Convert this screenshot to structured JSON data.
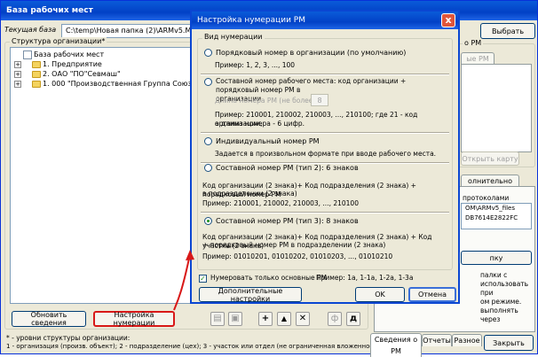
{
  "main": {
    "title": "База рабочих мест",
    "current_base_label": "Текущая база",
    "current_base_value": "C:\\temp\\Новая папка (2)\\ARMv5.MDB",
    "select_button": "Выбрать",
    "org_structure_label": "Структура организации*",
    "tree": [
      {
        "label": "База рабочих мест"
      },
      {
        "label": "1. Предприятие"
      },
      {
        "label": "2. ОАО \"ПО\"Севмаш\""
      },
      {
        "label": "1. 000 \"Производственная Группа СоюзПрофи"
      }
    ],
    "update_button": "Обновить сведения",
    "numbering_button": "Настройка нумерации",
    "tool_icons": [
      "add-icon",
      "up-arrow-icon",
      "delete-icon",
      "f-letter-icon",
      "d-letter-icon"
    ],
    "tool_letters": {
      "add": "+",
      "up": "▲",
      "del": "✕",
      "f": "ф",
      "d": "д"
    },
    "footnote_line1": "* - уровни структуры организации:",
    "footnote_line2": "1 - организация (произв. объект); 2 - подразделение (цех); 3 - участок или отдел (не ограниченная вложенность).",
    "right_panel": {
      "group_label": "о РМ",
      "inner_tab": "ые РМ",
      "open_card_button": "Открыть карту",
      "tab_more": "олнительно",
      "protocols_label": "протоколами",
      "path_line1": "OM\\ARMv5_files",
      "path_line2": "DB7614E2822FC",
      "button_short": "пку",
      "desc_lines": [
        "палки с",
        "использовать при",
        "ом режиме.",
        "выполнять через"
      ],
      "bottom_tabs": [
        "Сведения о РМ",
        "Отчеты",
        "Разное"
      ],
      "close_button": "Закрыть"
    }
  },
  "dialog": {
    "title": "Настройка нумерации РМ",
    "group_label": "Вид нумерации",
    "options": [
      {
        "title": "Порядковый номер в организации (по умолчанию)",
        "lines": [
          "Пример: 1, 2, 3, ..., 100"
        ],
        "selected": false
      },
      {
        "title": "Составной номер рабочего места: код организации + порядковый номер РМ в",
        "title2": "организации",
        "length_label": "Длина номера РМ (не более 8):",
        "length_value": "8",
        "lines": [
          "Пример: 210001, 210002, 210003, ..., 210100; где 21 - код организации,",
          "а длина номера - 6 цифр."
        ],
        "selected": false
      },
      {
        "title": "Индивидуальный номер РМ",
        "lines": [
          "Задается в произвольном формате при вводе рабочего места."
        ],
        "selected": false
      },
      {
        "title": "Составной номер РМ (тип 2): 6 знаков",
        "lines": [
          "Код организации (2 знака)+ Код подразделения (2 знака) + порядковый номер РМ",
          "в подразделении (2 знака)",
          "Пример: 210001, 210002, 210003, ..., 210100"
        ],
        "selected": false
      },
      {
        "title": "Составной номер РМ (тип 3): 8 знаков",
        "lines": [
          "Код организации (2 знака)+ Код подразделения (2 знака) + Код участка (2 знака)",
          "+ порядковый номер РМ в подразделении (2 знака)",
          "Пример: 01010201, 01010202, 01010203, ..., 01010210"
        ],
        "selected": true
      }
    ],
    "checkbox_label": "Нумеровать только основные РМ",
    "example_text": "Пример: 1а, 1-1а, 1-2а, 1-3а",
    "advanced_button": "Дополнительные настройки",
    "ok_button": "OK",
    "cancel_button": "Отмена",
    "close_glyph": "x"
  },
  "colors": {
    "annotation_arrow": "#d81818",
    "titlebar": "#0a5bd9"
  }
}
